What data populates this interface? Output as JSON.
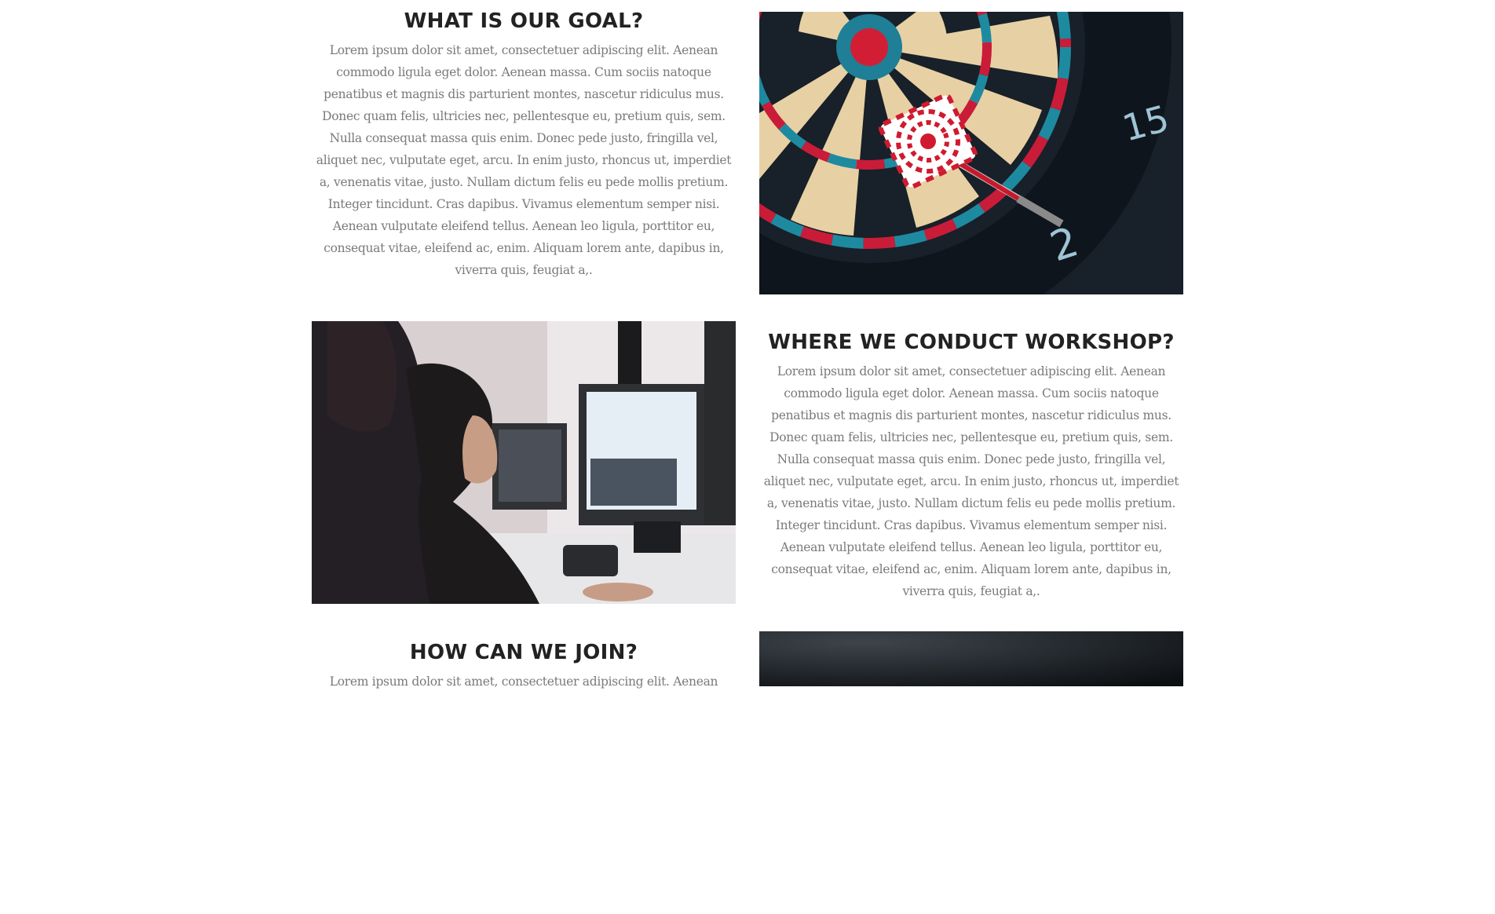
{
  "sections": [
    {
      "title": "WHAT IS OUR GOAL?",
      "body": "Lorem ipsum dolor sit amet, consectetuer adipiscing elit. Aenean commodo ligula eget dolor. Aenean massa. Cum sociis natoque penatibus et magnis dis parturient montes, nascetur ridiculus mus. Donec quam felis, ultricies nec, pellentesque eu, pretium quis, sem. Nulla consequat massa quis enim. Donec pede justo, fringilla vel, aliquet nec, vulputate eget, arcu. In enim justo, rhoncus ut, imperdiet a, venenatis vitae, justo. Nullam dictum felis eu pede mollis pretium. Integer tincidunt. Cras dapibus. Vivamus elementum semper nisi. Aenean vulputate eleifend tellus. Aenean leo ligula, porttitor eu, consequat vitae, eleifend ac, enim. Aliquam lorem ante, dapibus in, viverra quis, feugiat a,."
    },
    {
      "title": "WHERE WE CONDUCT WORKSHOP?",
      "body": "Lorem ipsum dolor sit amet, consectetuer adipiscing elit. Aenean commodo ligula eget dolor. Aenean massa. Cum sociis natoque penatibus et magnis dis parturient montes, nascetur ridiculus mus. Donec quam felis, ultricies nec, pellentesque eu, pretium quis, sem. Nulla consequat massa quis enim. Donec pede justo, fringilla vel, aliquet nec, vulputate eget, arcu. In enim justo, rhoncus ut, imperdiet a, venenatis vitae, justo. Nullam dictum felis eu pede mollis pretium. Integer tincidunt. Cras dapibus. Vivamus elementum semper nisi. Aenean vulputate eleifend tellus. Aenean leo ligula, porttitor eu, consequat vitae, eleifend ac, enim. Aliquam lorem ante, dapibus in, viverra quis, feugiat a,."
    },
    {
      "title": "HOW CAN WE JOIN?",
      "body": "Lorem ipsum dolor sit amet, consectetuer adipiscing elit. Aenean"
    }
  ],
  "images": {
    "dartboard": {
      "numbers": [
        "15",
        "2"
      ]
    }
  },
  "colors": {
    "heading": "#222222",
    "body_text": "#7a7a7a",
    "background": "#ffffff"
  }
}
